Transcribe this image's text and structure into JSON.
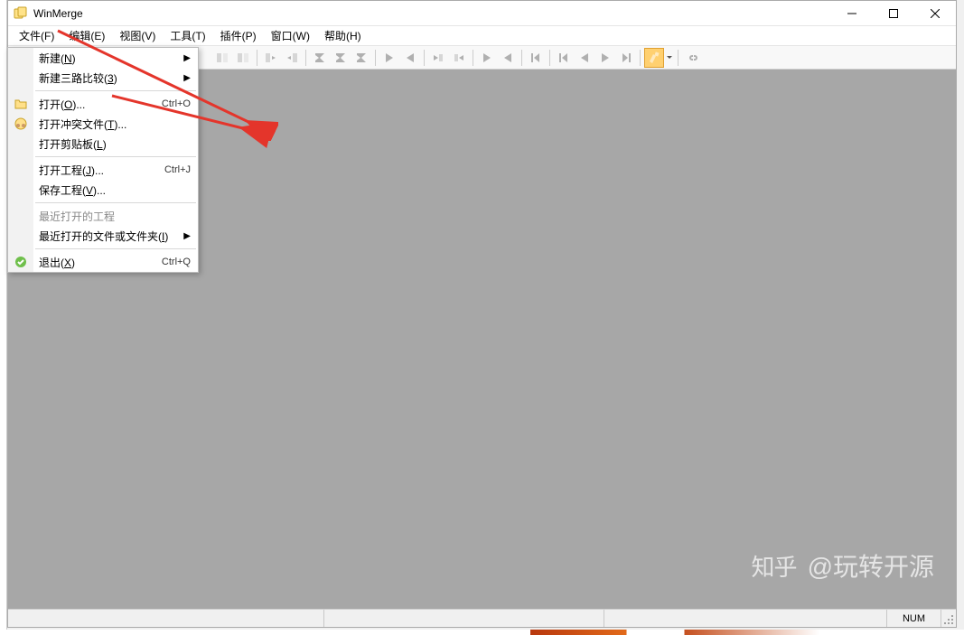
{
  "window": {
    "title": "WinMerge"
  },
  "menubar": [
    {
      "label": "文件(F)",
      "key": "file"
    },
    {
      "label": "编辑(E)",
      "key": "edit"
    },
    {
      "label": "视图(V)",
      "key": "view"
    },
    {
      "label": "工具(T)",
      "key": "tools"
    },
    {
      "label": "插件(P)",
      "key": "plugins"
    },
    {
      "label": "窗口(W)",
      "key": "window"
    },
    {
      "label": "帮助(H)",
      "key": "help"
    }
  ],
  "toolbar": {
    "buttons": [
      {
        "name": "diff-docs-icon"
      },
      {
        "name": "diff-side-icon"
      },
      {
        "sep": true
      },
      {
        "name": "copy-left-block-icon"
      },
      {
        "name": "copy-right-block-icon"
      },
      {
        "sep": true
      },
      {
        "name": "sigma-left-icon"
      },
      {
        "name": "sigma-right-icon"
      },
      {
        "name": "sigma-icon"
      },
      {
        "sep": true
      },
      {
        "name": "nav-right-icon"
      },
      {
        "name": "nav-left-icon"
      },
      {
        "sep": true
      },
      {
        "name": "diff-next-small-icon"
      },
      {
        "name": "diff-prev-small-icon"
      },
      {
        "sep": true
      },
      {
        "name": "play-next-icon"
      },
      {
        "name": "play-prev-icon"
      },
      {
        "sep": true
      },
      {
        "name": "skip-first-pair-icon"
      },
      {
        "sep": true
      },
      {
        "name": "skip-first-icon"
      },
      {
        "name": "skip-prev-icon"
      },
      {
        "name": "skip-next-icon"
      },
      {
        "name": "skip-last-icon"
      },
      {
        "sep": true
      },
      {
        "name": "highlight-toggle-icon",
        "highlighted": true,
        "dropdown": true
      },
      {
        "sep": true
      },
      {
        "name": "link-icon"
      }
    ]
  },
  "file_menu": {
    "items": [
      {
        "label": "新建(",
        "uchar": "N",
        "tail": ")",
        "submenu": true,
        "icon": null
      },
      {
        "label": "新建三路比较(",
        "uchar": "3",
        "tail": ")",
        "submenu": true,
        "icon": null
      },
      {
        "sep": true
      },
      {
        "label": "打开(",
        "uchar": "O",
        "tail": ")...",
        "shortcut": "Ctrl+O",
        "icon": "folder-icon"
      },
      {
        "label": "打开冲突文件(",
        "uchar": "T",
        "tail": ")...",
        "icon": "conflict-icon"
      },
      {
        "label": "打开剪贴板(",
        "uchar": "L",
        "tail": ")"
      },
      {
        "sep": true
      },
      {
        "label": "打开工程(",
        "uchar": "J",
        "tail": ")...",
        "shortcut": "Ctrl+J"
      },
      {
        "label": "保存工程(",
        "uchar": "V",
        "tail": ")..."
      },
      {
        "sep": true
      },
      {
        "label": "最近打开的工程",
        "disabled": true
      },
      {
        "label": "最近打开的文件或文件夹(",
        "uchar": "I",
        "tail": ")",
        "submenu": true
      },
      {
        "sep": true
      },
      {
        "label": "退出(",
        "uchar": "X",
        "tail": ")",
        "shortcut": "Ctrl+Q",
        "icon": "exit-icon"
      }
    ]
  },
  "statusbar": {
    "num": "NUM"
  },
  "watermark": {
    "logo": "知乎",
    "text": "@玩转开源"
  }
}
